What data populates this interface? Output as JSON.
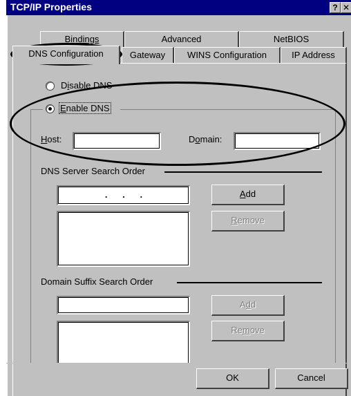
{
  "window": {
    "title": "TCP/IP Properties",
    "help_label": "?",
    "close_label": "✕"
  },
  "tabs": {
    "row1": [
      {
        "label": "Bindings"
      },
      {
        "label": "Advanced"
      },
      {
        "label": "NetBIOS"
      }
    ],
    "row2": [
      {
        "label": "DNS Configuration",
        "active": true
      },
      {
        "label": "Gateway"
      },
      {
        "label": "WINS Configuration"
      },
      {
        "label": "IP Address"
      }
    ]
  },
  "dns": {
    "disable_label_pre": "D",
    "disable_label_u": "i",
    "disable_label_post": "sable DNS",
    "enable_label_u": "E",
    "enable_label_post": "nable DNS",
    "selected": "enable",
    "host_label_u": "H",
    "host_label_post": "ost:",
    "host_value": "",
    "domain_label_pre": "D",
    "domain_label_u": "o",
    "domain_label_post": "main:",
    "domain_value": ""
  },
  "server_order": {
    "title": "DNS Server Search Order",
    "ip_dots": ".      .      .",
    "add_label_u": "A",
    "add_label_post": "dd",
    "remove_label_u": "R",
    "remove_label_post": "emove",
    "list": []
  },
  "suffix_order": {
    "title": "Domain Suffix Search Order",
    "input_value": "",
    "add_label_pre": "A",
    "add_label_u": "d",
    "add_label_post": "d",
    "remove_label_pre": "Re",
    "remove_label_u": "m",
    "remove_label_post": "ove",
    "list": []
  },
  "footer": {
    "ok_label": "OK",
    "cancel_label": "Cancel"
  }
}
